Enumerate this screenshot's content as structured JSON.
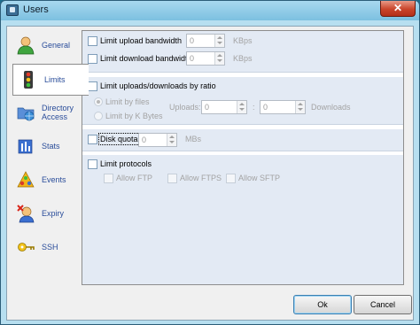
{
  "window": {
    "title": "Users",
    "close_glyph": "✕"
  },
  "nav": {
    "items": [
      {
        "label": "General",
        "icon": "user-icon"
      },
      {
        "label": "Limits",
        "icon": "traffic-light-icon",
        "active": true
      },
      {
        "label": "Directory Access",
        "line1": "Directory",
        "line2": "Access",
        "icon": "folder-network-icon"
      },
      {
        "label": "Stats",
        "icon": "stats-icon"
      },
      {
        "label": "Events",
        "icon": "events-icon"
      },
      {
        "label": "Expiry",
        "icon": "expiry-icon"
      },
      {
        "label": "SSH",
        "icon": "ssh-key-icon"
      }
    ]
  },
  "limits": {
    "upload": {
      "label": "Limit upload bandwidth",
      "value": "0",
      "unit": "KBps"
    },
    "download": {
      "label": "Limit download bandwidth",
      "value": "0",
      "unit": "KBps"
    },
    "ratio": {
      "label": "Limit uploads/downloads by ratio",
      "by_files": "Limit by files",
      "by_kbytes": "Limit by K Bytes",
      "uploads_label": "Uploads:",
      "uploads_value": "0",
      "separator": ":",
      "downloads_value": "0",
      "downloads_label": "Downloads"
    },
    "quota": {
      "label": "Disk quota",
      "value": "0",
      "unit": "MBs"
    },
    "protocols": {
      "label": "Limit protocols",
      "ftp": "Allow FTP",
      "ftps": "Allow FTPS",
      "sftp": "Allow SFTP"
    }
  },
  "buttons": {
    "ok": "Ok",
    "cancel": "Cancel"
  },
  "colors": {
    "accent": "#2a4d9a",
    "group_bg": "#e3eaf4",
    "titlebar": "#a8d8ef",
    "close": "#c9452b"
  }
}
